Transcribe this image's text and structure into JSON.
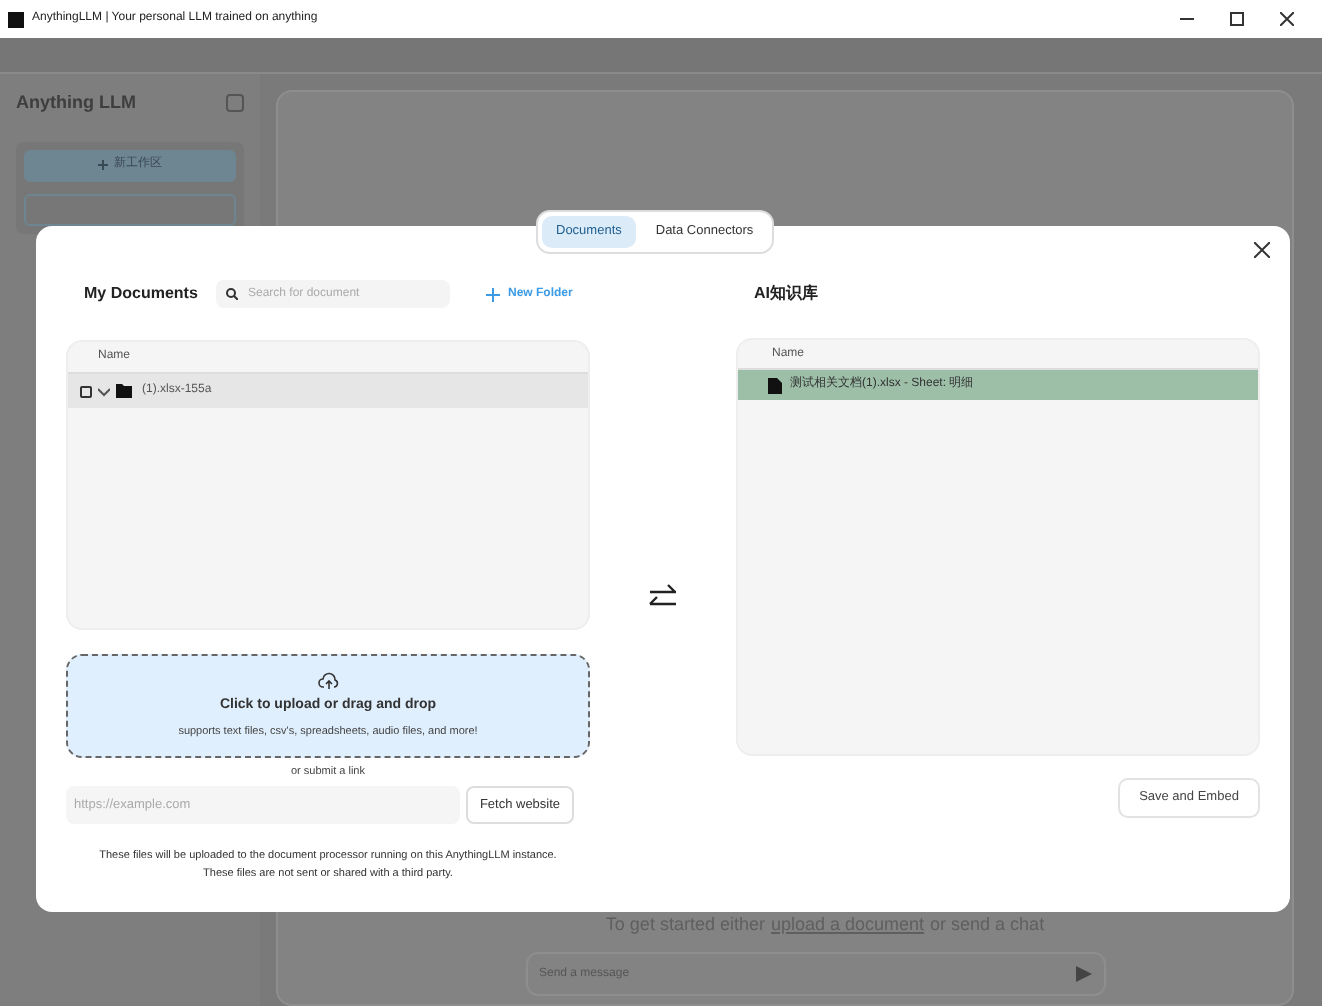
{
  "window": {
    "title": "AnythingLLM | Your personal LLM trained on anything"
  },
  "background": {
    "app_name": "Anything LLM",
    "new_workspace_button": "新工作区",
    "empty_message": {
      "before": "To get started either",
      "link": "upload a document",
      "after": "or send a chat"
    },
    "message_placeholder": "Send a message"
  },
  "modal": {
    "tabs": [
      {
        "label": "Documents",
        "selected": true
      },
      {
        "label": "Data Connectors",
        "selected": false
      }
    ],
    "my_documents": {
      "title": "My Documents",
      "search_placeholder": "Search for document",
      "new_folder": "New Folder",
      "column": "Name",
      "items": [
        {
          "kind": "folder",
          "name": "(1).xlsx-155a",
          "checked": false,
          "expanded": true,
          "selected": true
        }
      ]
    },
    "upload": {
      "title": "Click to upload or drag and drop",
      "subtitle": "supports text files, csv's, spreadsheets, audio files, and more!",
      "link_hint": "or submit a link",
      "url_placeholder": "https://example.com",
      "fetch_button": "Fetch website",
      "notice": [
        "These files will be uploaded to the document processor running on this AnythingLLM instance.",
        "These files are not sent or shared with a third party."
      ]
    },
    "workspace": {
      "title": "AI知识库",
      "column": "Name",
      "items": [
        {
          "kind": "file",
          "name": "测试相关文档(1).xlsx - Sheet: 明细",
          "selected": true
        }
      ],
      "save_button": "Save and Embed"
    }
  }
}
